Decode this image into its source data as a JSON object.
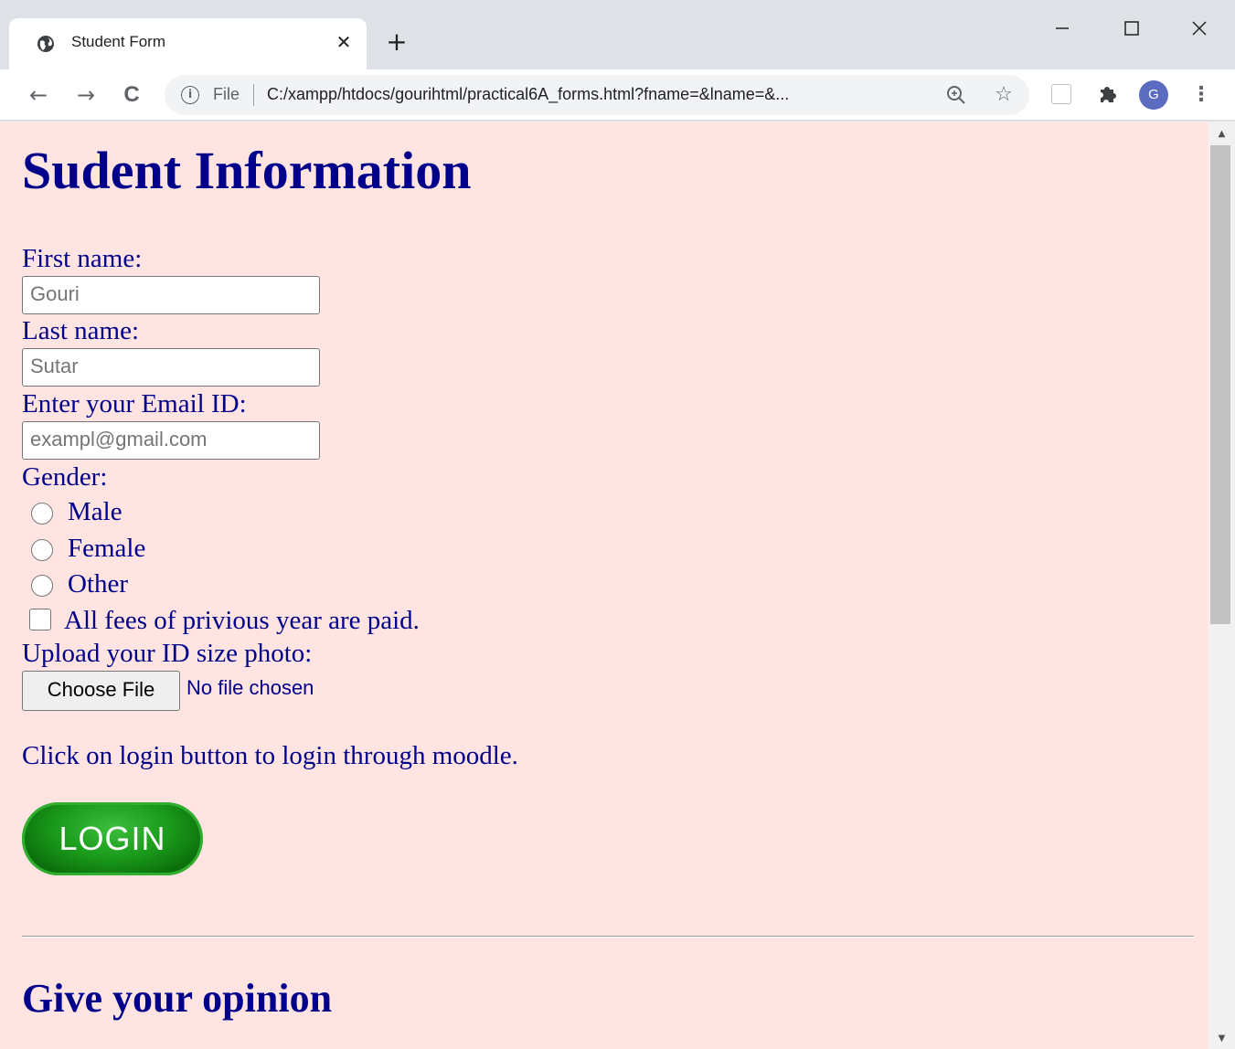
{
  "browser": {
    "tab_title": "Student Form",
    "tab_close": "✕",
    "new_tab": "+",
    "window_controls": {
      "minimize": "—",
      "maximize": "☐",
      "close": "✕"
    },
    "nav": {
      "back": "←",
      "forward": "→",
      "reload": "C"
    },
    "omnibox": {
      "scheme": "File",
      "url": "C:/xampp/htdocs/gourihtml/practical6A_forms.html?fname=&lname=&..."
    },
    "avatar_letter": "G",
    "icons": [
      "globe-icon",
      "info-icon",
      "zoom-icon",
      "star-icon",
      "extension-icon",
      "puzzle-icon",
      "menu-icon"
    ]
  },
  "page": {
    "heading": "Sudent Information",
    "first_name": {
      "label": "First name:",
      "placeholder": "Gouri"
    },
    "last_name": {
      "label": "Last name:",
      "placeholder": "Sutar"
    },
    "email": {
      "label": "Enter your Email ID:",
      "placeholder": "exampl@gmail.com"
    },
    "gender": {
      "label": "Gender:",
      "options": [
        "Male",
        "Female",
        "Other"
      ]
    },
    "fees_checkbox_label": "All fees of privious year are paid.",
    "upload": {
      "label": "Upload your ID size photo:",
      "button": "Choose File",
      "status": "No file chosen"
    },
    "login_text": "Click on login button to login through moodle.",
    "login_button": "LOGIN",
    "opinion_heading": "Give your opinion"
  },
  "colors": {
    "page_background": "#ffe4e1",
    "text": "#00008b",
    "login_green": "#1a9a1a"
  }
}
